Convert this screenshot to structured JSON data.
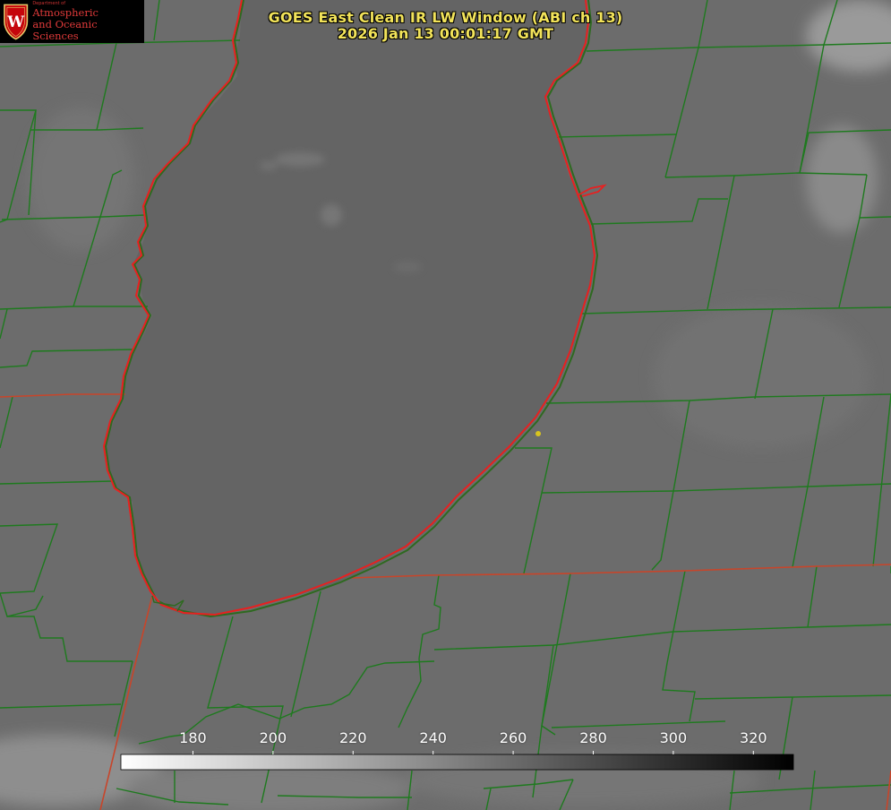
{
  "title": {
    "line1": "GOES East Clean IR LW Window (ABI ch 13)",
    "line2": "2026 Jan 13 00:01:17 GMT"
  },
  "logo": {
    "department": "Department of",
    "line1": "Atmospheric",
    "line2": "and Oceanic Sciences",
    "crest_letter": "W"
  },
  "colorbar": {
    "ticks": [
      "180",
      "200",
      "220",
      "240",
      "260",
      "280",
      "300",
      "320"
    ],
    "tick_values": [
      180,
      200,
      220,
      240,
      260,
      280,
      300,
      320
    ],
    "range_min": 162,
    "range_max": 330,
    "gradient": "white-to-black"
  },
  "colors": {
    "county_lines": "#1e7a1e",
    "state_lines": "#c8452a",
    "lake_outline": "#e82020",
    "title_text": "#f2e35a",
    "station_marker": "#d8c41e"
  }
}
